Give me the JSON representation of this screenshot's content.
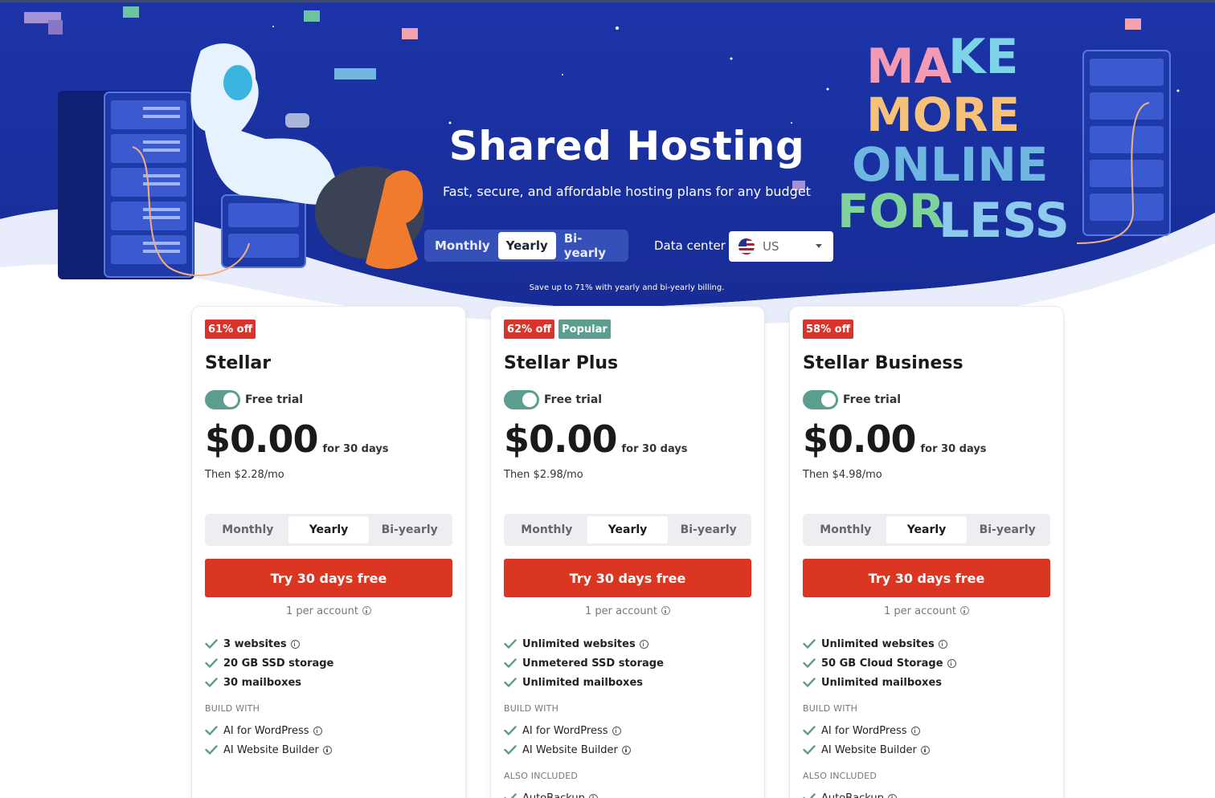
{
  "hero": {
    "title": "Shared Hosting",
    "subtitle": "Fast, secure, and affordable hosting plans for any budget",
    "billing_options": [
      "Monthly",
      "Yearly",
      "Bi-yearly"
    ],
    "billing_selected": "Yearly",
    "data_center_label": "Data center",
    "data_center_value": "US",
    "save_note": "Save up to 71% with yearly and bi-yearly billing.",
    "artwork_text": "MAKE MORE ONLINE FOR LESS"
  },
  "colors": {
    "hero_bg": "#1b33a4",
    "cta": "#da3622",
    "discount_badge": "#d9342b",
    "popular_badge": "#5b9e8f",
    "toggle": "#5b9e8f"
  },
  "plans": [
    {
      "discount": "61% off",
      "name": "Stellar",
      "free_trial_label": "Free trial",
      "free_trial_on": true,
      "price": "$0.00",
      "price_period": "for 30 days",
      "then": "Then $2.28/mo",
      "billing": [
        "Monthly",
        "Yearly",
        "Bi-yearly"
      ],
      "billing_selected": "Yearly",
      "cta": "Try 30 days free",
      "per_account": "1 per account",
      "features": [
        "3 websites",
        "20 GB SSD storage",
        "30 mailboxes"
      ],
      "build_with_label": "BUILD WITH",
      "build_with": [
        "AI for WordPress",
        "AI Website Builder"
      ]
    },
    {
      "discount": "62% off",
      "tag": "Popular",
      "name": "Stellar Plus",
      "free_trial_label": "Free trial",
      "free_trial_on": true,
      "price": "$0.00",
      "price_period": "for 30 days",
      "then": "Then $2.98/mo",
      "billing": [
        "Monthly",
        "Yearly",
        "Bi-yearly"
      ],
      "billing_selected": "Yearly",
      "cta": "Try 30 days free",
      "per_account": "1 per account",
      "features": [
        "Unlimited websites",
        "Unmetered SSD storage",
        "Unlimited mailboxes"
      ],
      "build_with_label": "BUILD WITH",
      "build_with": [
        "AI for WordPress",
        "AI Website Builder"
      ],
      "also_included_label": "ALSO INCLUDED",
      "also_included": [
        "AutoBackup"
      ]
    },
    {
      "discount": "58% off",
      "name": "Stellar Business",
      "free_trial_label": "Free trial",
      "free_trial_on": true,
      "price": "$0.00",
      "price_period": "for 30 days",
      "then": "Then $4.98/mo",
      "billing": [
        "Monthly",
        "Yearly",
        "Bi-yearly"
      ],
      "billing_selected": "Yearly",
      "cta": "Try 30 days free",
      "per_account": "1 per account",
      "features": [
        "Unlimited websites",
        "50 GB Cloud Storage",
        "Unlimited mailboxes"
      ],
      "build_with_label": "BUILD WITH",
      "build_with": [
        "AI for WordPress",
        "AI Website Builder"
      ],
      "also_included_label": "ALSO INCLUDED",
      "also_included": [
        "AutoBackup"
      ]
    }
  ]
}
